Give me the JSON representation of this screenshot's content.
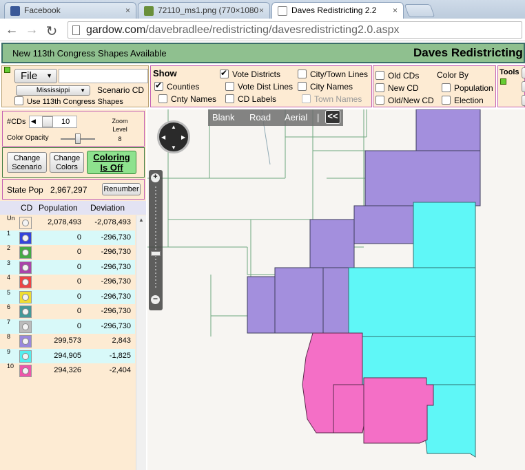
{
  "browser": {
    "tabs": [
      {
        "label": "Facebook",
        "icon": "facebook-icon",
        "icon_color": "#3b5998"
      },
      {
        "label": "72110_ms1.png (770×1080",
        "icon": "image-icon",
        "icon_color": "#6a8f3a"
      },
      {
        "label": "Daves Redistricting 2.2",
        "icon": "page-icon",
        "icon_color": "#ffffff"
      }
    ],
    "close_glyph": "×",
    "url_host": "gardow.com",
    "url_path": "/davebradlee/redistricting/davesredistricting2.0.aspx"
  },
  "banner": {
    "notice": "New 113th Congress Shapes Available",
    "app_title": "Daves Redistricting",
    "color": "#8fc08f"
  },
  "file_panel": {
    "file_label": "File",
    "state": "Mississippi",
    "scenario_label": "Scenario CD",
    "use113_label": "Use 113th Congress Shapes"
  },
  "show_panel": {
    "title": "Show",
    "options": {
      "vote_districts": "Vote Districts",
      "counties": "Counties",
      "cnty_names": "Cnty Names",
      "vote_dist_lines": "Vote Dist Lines",
      "cd_labels": "CD Labels",
      "city_town_lines": "City/Town Lines",
      "city_names": "City Names",
      "town_names": "Town Names"
    }
  },
  "colorby_panel": {
    "old_cds": "Old CDs",
    "new_cd": "New CD",
    "old_new_cd": "Old/New CD",
    "title": "Color By",
    "population": "Population",
    "election": "Election"
  },
  "tools_panel": {
    "title": "Tools"
  },
  "controls": {
    "cds_label": "#CDs",
    "cds_value": "10",
    "opacity_label": "Color Opacity",
    "zoom_label": "Zoom Level",
    "zoom_value": "8",
    "change_scenario": "Change Scenario",
    "change_colors": "Change Colors",
    "coloring": "Coloring Is Off",
    "state_pop_label": "State Pop",
    "state_pop_value": "2,967,297",
    "renumber": "Renumber"
  },
  "table": {
    "headers": [
      "CD",
      "Population",
      "Deviation"
    ],
    "rows": [
      {
        "cd": "Un",
        "color": "#ffffff",
        "pop": "2,078,493",
        "dev": "-2,078,493"
      },
      {
        "cd": "1",
        "color": "#3344dd",
        "pop": "0",
        "dev": "-296,730"
      },
      {
        "cd": "2",
        "color": "#44aa44",
        "pop": "0",
        "dev": "-296,730"
      },
      {
        "cd": "3",
        "color": "#aa44aa",
        "pop": "0",
        "dev": "-296,730"
      },
      {
        "cd": "4",
        "color": "#ee4444",
        "pop": "0",
        "dev": "-296,730"
      },
      {
        "cd": "5",
        "color": "#eedd33",
        "pop": "0",
        "dev": "-296,730"
      },
      {
        "cd": "6",
        "color": "#449999",
        "pop": "0",
        "dev": "-296,730"
      },
      {
        "cd": "7",
        "color": "#bbbbbb",
        "pop": "0",
        "dev": "-296,730"
      },
      {
        "cd": "8",
        "color": "#9988dd",
        "pop": "299,573",
        "dev": "2,843"
      },
      {
        "cd": "9",
        "color": "#55eeee",
        "pop": "294,905",
        "dev": "-1,825"
      },
      {
        "cd": "10",
        "color": "#ee55aa",
        "pop": "294,326",
        "dev": "-2,404"
      }
    ]
  },
  "map": {
    "tabs": {
      "blank": "Blank",
      "road": "Road",
      "aerial": "Aerial",
      "divider": "|",
      "collapse": "<<"
    },
    "colors": {
      "cd8": "#a38fdd",
      "cd9": "#5ff7f7",
      "cd10": "#f46fc6"
    }
  }
}
